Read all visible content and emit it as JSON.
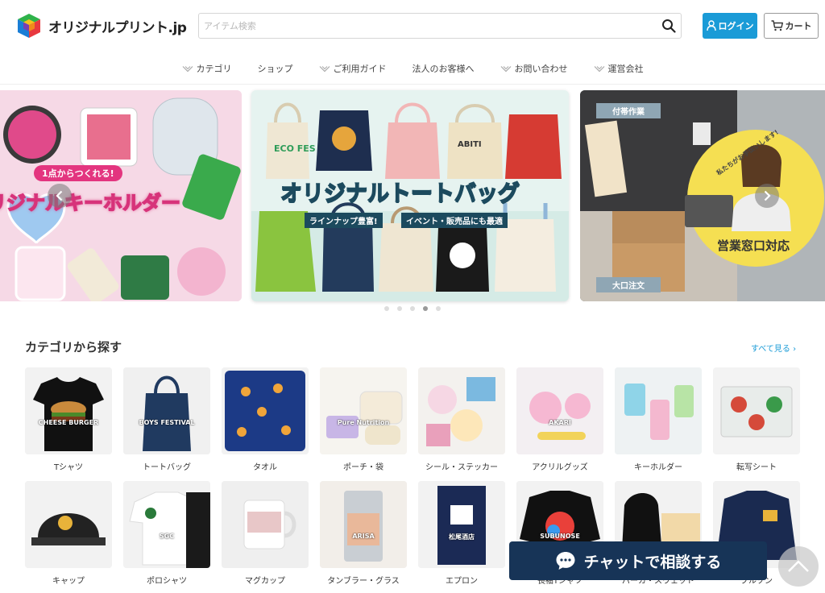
{
  "header": {
    "logo_text": "オリジナルプリント.jp",
    "search_placeholder": "アイテム検索",
    "login_label": "ログイン",
    "cart_label": "カート"
  },
  "nav": {
    "items": [
      {
        "label": "カテゴリ",
        "has_chevron": true
      },
      {
        "label": "ショップ",
        "has_chevron": false
      },
      {
        "label": "ご利用ガイド",
        "has_chevron": true
      },
      {
        "label": "法人のお客様へ",
        "has_chevron": false
      },
      {
        "label": "お問い合わせ",
        "has_chevron": true
      },
      {
        "label": "運営会社",
        "has_chevron": true
      }
    ]
  },
  "carousel": {
    "slides": [
      {
        "title": "オリジナルキーホルダー",
        "badge": "1点からつくれる!",
        "bg": "#f7dce8"
      },
      {
        "title": "オリジナルトートバッグ",
        "chips": [
          "ラインナップ豊富!",
          "イベント・販売品にも最適"
        ],
        "product_texts": [
          "ECO FES",
          "ABITI"
        ],
        "bg": "#e4f2ef"
      },
      {
        "title": "営業窓口対応",
        "circle_sub": "私たちがお手伝いします!",
        "tags": [
          "付帯作業",
          "大口注文"
        ],
        "bg": "#9a9b99"
      }
    ],
    "dot_count": 5,
    "active_dot": 3
  },
  "categories": {
    "title": "カテゴリから探す",
    "see_all": "すべて見る",
    "items": [
      {
        "label": "Tシャツ",
        "img_text": "CHEESE BURGER"
      },
      {
        "label": "トートバッグ",
        "img_text": "BOYS FESTIVAL"
      },
      {
        "label": "タオル",
        "img_text": ""
      },
      {
        "label": "ポーチ・袋",
        "img_text": "Pure Nutrition"
      },
      {
        "label": "シール・ステッカー",
        "img_text": ""
      },
      {
        "label": "アクリルグッズ",
        "img_text": "AKARI"
      },
      {
        "label": "キーホルダー",
        "img_text": ""
      },
      {
        "label": "転写シート",
        "img_text": ""
      },
      {
        "label": "キャップ",
        "img_text": ""
      },
      {
        "label": "ポロシャツ",
        "img_text": "SGC"
      },
      {
        "label": "マグカップ",
        "img_text": ""
      },
      {
        "label": "タンブラー・グラス",
        "img_text": "ARISA"
      },
      {
        "label": "エプロン",
        "img_text": "松尾酒店"
      },
      {
        "label": "長袖Tシャツ",
        "img_text": "SUBUNOSE"
      },
      {
        "label": "パーカ・スウェット",
        "img_text": ""
      },
      {
        "label": "ブルゾン",
        "img_text": ""
      }
    ]
  },
  "chat": {
    "label": "チャットで相談する"
  },
  "colors": {
    "accent": "#1a9bd7",
    "chat_bg": "#173457"
  }
}
